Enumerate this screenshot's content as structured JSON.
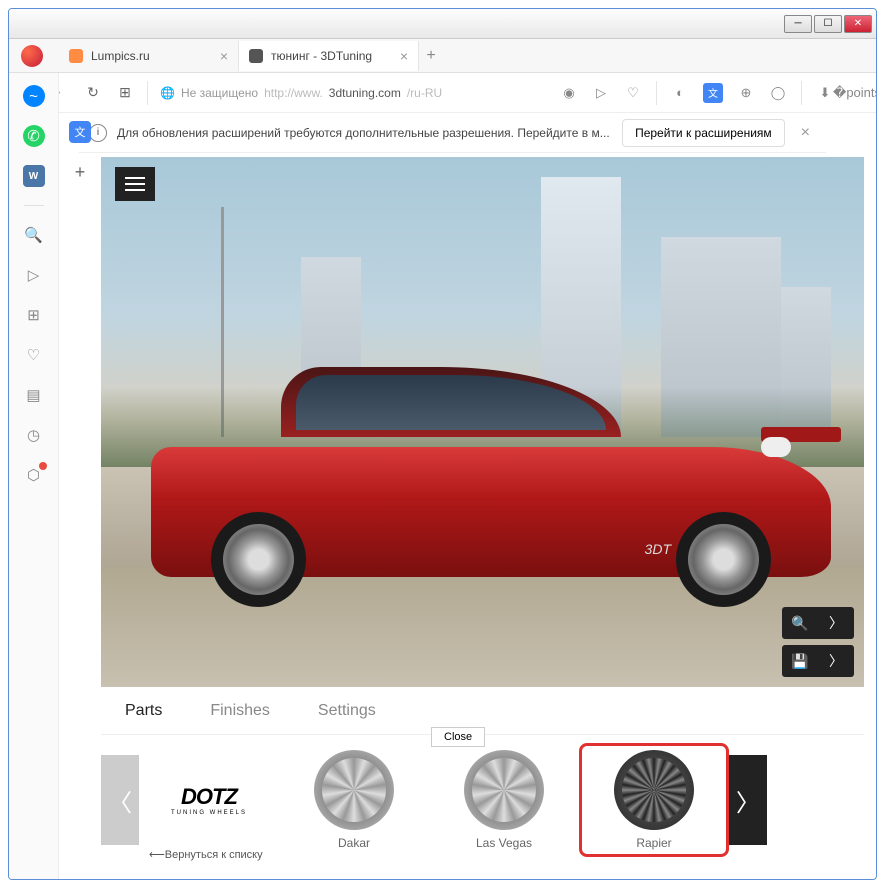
{
  "window": {
    "tabs": [
      {
        "title": "Lumpics.ru",
        "active": false
      },
      {
        "title": "тюнинг - 3DTuning",
        "active": true
      }
    ],
    "addressbar": {
      "security_label": "Не защищено",
      "url_prefix": "http://www.",
      "url_host": "3dtuning.com",
      "url_path": "/ru-RU"
    },
    "infobar": {
      "message": "Для обновления расширений требуются дополнительные разрешения. Перейдите в м...",
      "button": "Перейти к расширениям"
    }
  },
  "viewer": {
    "car_badge": "3DT"
  },
  "panel": {
    "tabs": [
      "Parts",
      "Finishes",
      "Settings"
    ],
    "active_tab": 0,
    "close_label": "Close",
    "brand": {
      "name": "DOTZ",
      "subtitle": "TUNING WHEELS"
    },
    "back_link": "Вернуться к списку",
    "wheels": [
      {
        "name": "Dakar",
        "highlighted": false
      },
      {
        "name": "Las Vegas",
        "highlighted": false
      },
      {
        "name": "Rapier",
        "highlighted": true
      }
    ]
  }
}
